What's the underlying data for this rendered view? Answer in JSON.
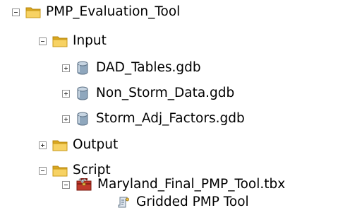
{
  "tree": {
    "root": {
      "label": "PMP_Evaluation_Tool",
      "expanded": true
    },
    "input": {
      "label": "Input",
      "expanded": true
    },
    "gdb1": {
      "label": "DAD_Tables.gdb",
      "expanded": false
    },
    "gdb2": {
      "label": "Non_Storm_Data.gdb",
      "expanded": false
    },
    "gdb3": {
      "label": "Storm_Adj_Factors.gdb",
      "expanded": false
    },
    "output": {
      "label": "Output",
      "expanded": false
    },
    "script": {
      "label": "Script",
      "expanded": true
    },
    "toolbox": {
      "label": "Maryland_Final_PMP_Tool.tbx",
      "expanded": true
    },
    "tool": {
      "label": "Gridded PMP Tool"
    }
  },
  "colors": {
    "folder": "#f1c232",
    "folder_dark": "#c99a1a",
    "database": "#8fa7bd",
    "toolbox": "#c0392b",
    "expander_border": "#919191"
  },
  "icons": {
    "folder": "folder-icon",
    "database": "database-icon",
    "toolbox": "toolbox-icon",
    "tool": "script-tool-icon",
    "expanded": "collapse-icon",
    "collapsed": "expand-icon"
  }
}
